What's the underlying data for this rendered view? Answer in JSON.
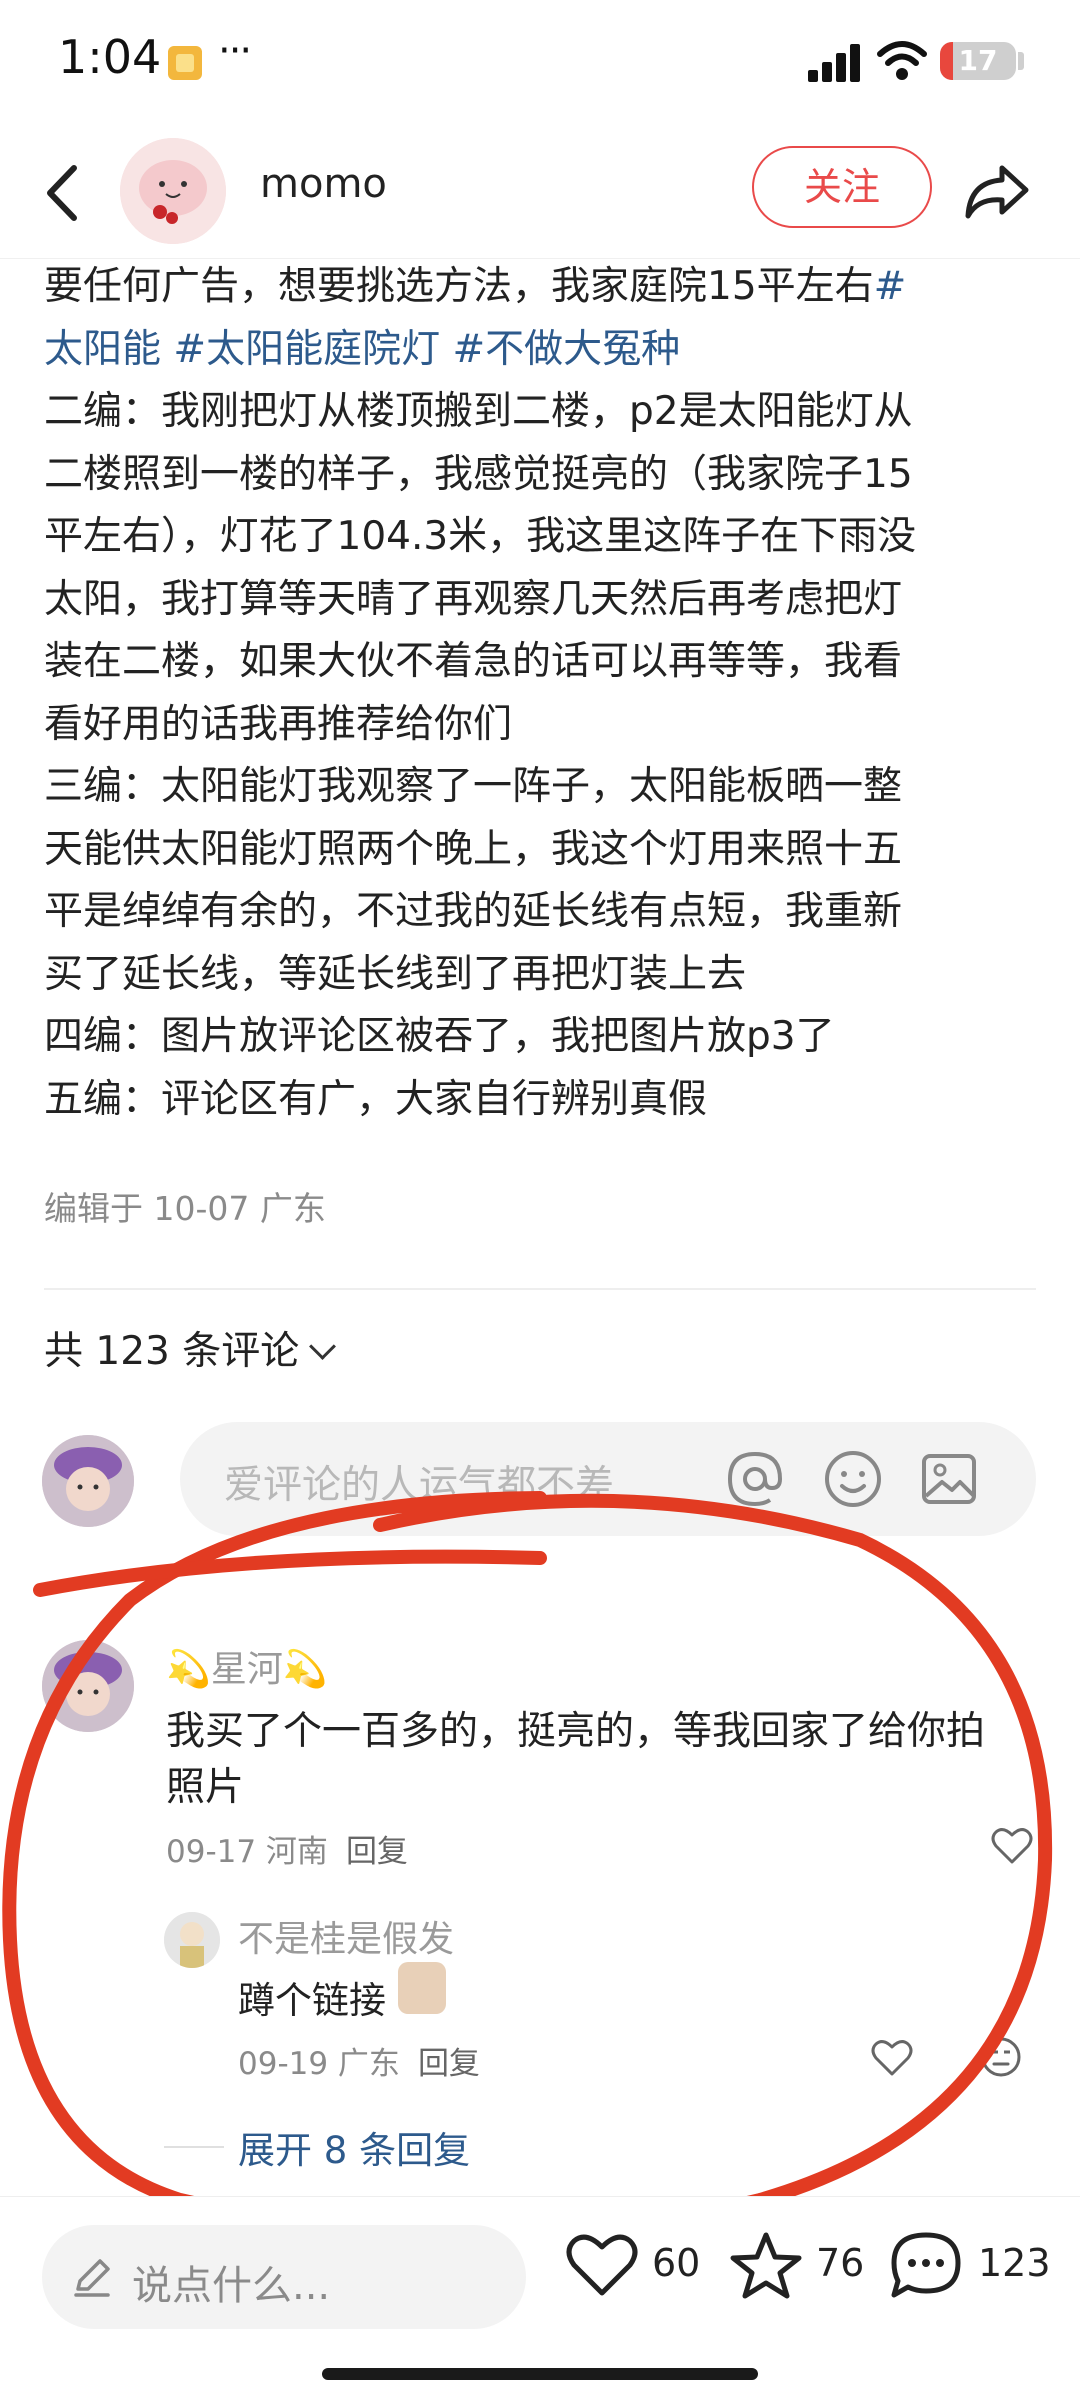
{
  "status_bar": {
    "time": "1:04",
    "more": "···",
    "battery": "17",
    "battery_level": 0.17
  },
  "header": {
    "author": "momo",
    "follow_label": "关注"
  },
  "article": {
    "lines": [
      {
        "text": "要任何广告，想要挑选方法，我家庭院15平左右",
        "tag": "#"
      },
      {
        "text": "",
        "tag": "太阳能 #太阳能庭院灯 #不做大冤种"
      },
      {
        "text": "二编：我刚把灯从楼顶搬到二楼，p2是太阳能灯从",
        "tag": ""
      },
      {
        "text": "二楼照到一楼的样子，我感觉挺亮的（我家院子15",
        "tag": ""
      },
      {
        "text": "平左右），灯花了104.3米，我这里这阵子在下雨没",
        "tag": ""
      },
      {
        "text": "太阳，我打算等天晴了再观察几天然后再考虑把灯",
        "tag": ""
      },
      {
        "text": "装在二楼，如果大伙不着急的话可以再等等，我看",
        "tag": ""
      },
      {
        "text": "看好用的话我再推荐给你们",
        "tag": ""
      },
      {
        "text": "三编：太阳能灯我观察了一阵子，太阳能板晒一整",
        "tag": ""
      },
      {
        "text": "天能供太阳能灯照两个晚上，我这个灯用来照十五",
        "tag": ""
      },
      {
        "text": "平是绰绰有余的，不过我的延长线有点短，我重新",
        "tag": ""
      },
      {
        "text": "买了延长线，等延长线到了再把灯装上去",
        "tag": ""
      },
      {
        "text": "四编：图片放评论区被吞了，我把图片放p3了",
        "tag": ""
      },
      {
        "text": "五编：评论区有广，大家自行辨别真假",
        "tag": ""
      }
    ],
    "edited": "编辑于 10-07 广东"
  },
  "comments_header": {
    "count_label": "共 123 条评论"
  },
  "comment_input": {
    "placeholder": "爱评论的人运气都不差"
  },
  "comment": {
    "name": "💫星河💫",
    "text_line1": "我买了个一百多的，挺亮的，等我回家了给你拍",
    "text_line2": "照片",
    "meta": "09-17 河南",
    "reply_label": "回复"
  },
  "reply": {
    "name": "不是桂是假发",
    "text": "蹲个链接",
    "meta": "09-19 广东",
    "reply_label": "回复"
  },
  "expand_label": "展开 8 条回复",
  "bottom_bar": {
    "placeholder": "说点什么...",
    "likes": "60",
    "stars": "76",
    "comments": "123"
  },
  "colors": {
    "accent_red": "#e94a4a",
    "link_blue": "#2d5a8c",
    "annotation_red": "#e23b22"
  },
  "icons": [
    "back-icon",
    "share-icon",
    "at-icon",
    "emoji-icon",
    "image-icon",
    "heart-icon",
    "star-icon",
    "comment-bubble-icon",
    "pen-icon",
    "dislike-emoji-icon"
  ]
}
